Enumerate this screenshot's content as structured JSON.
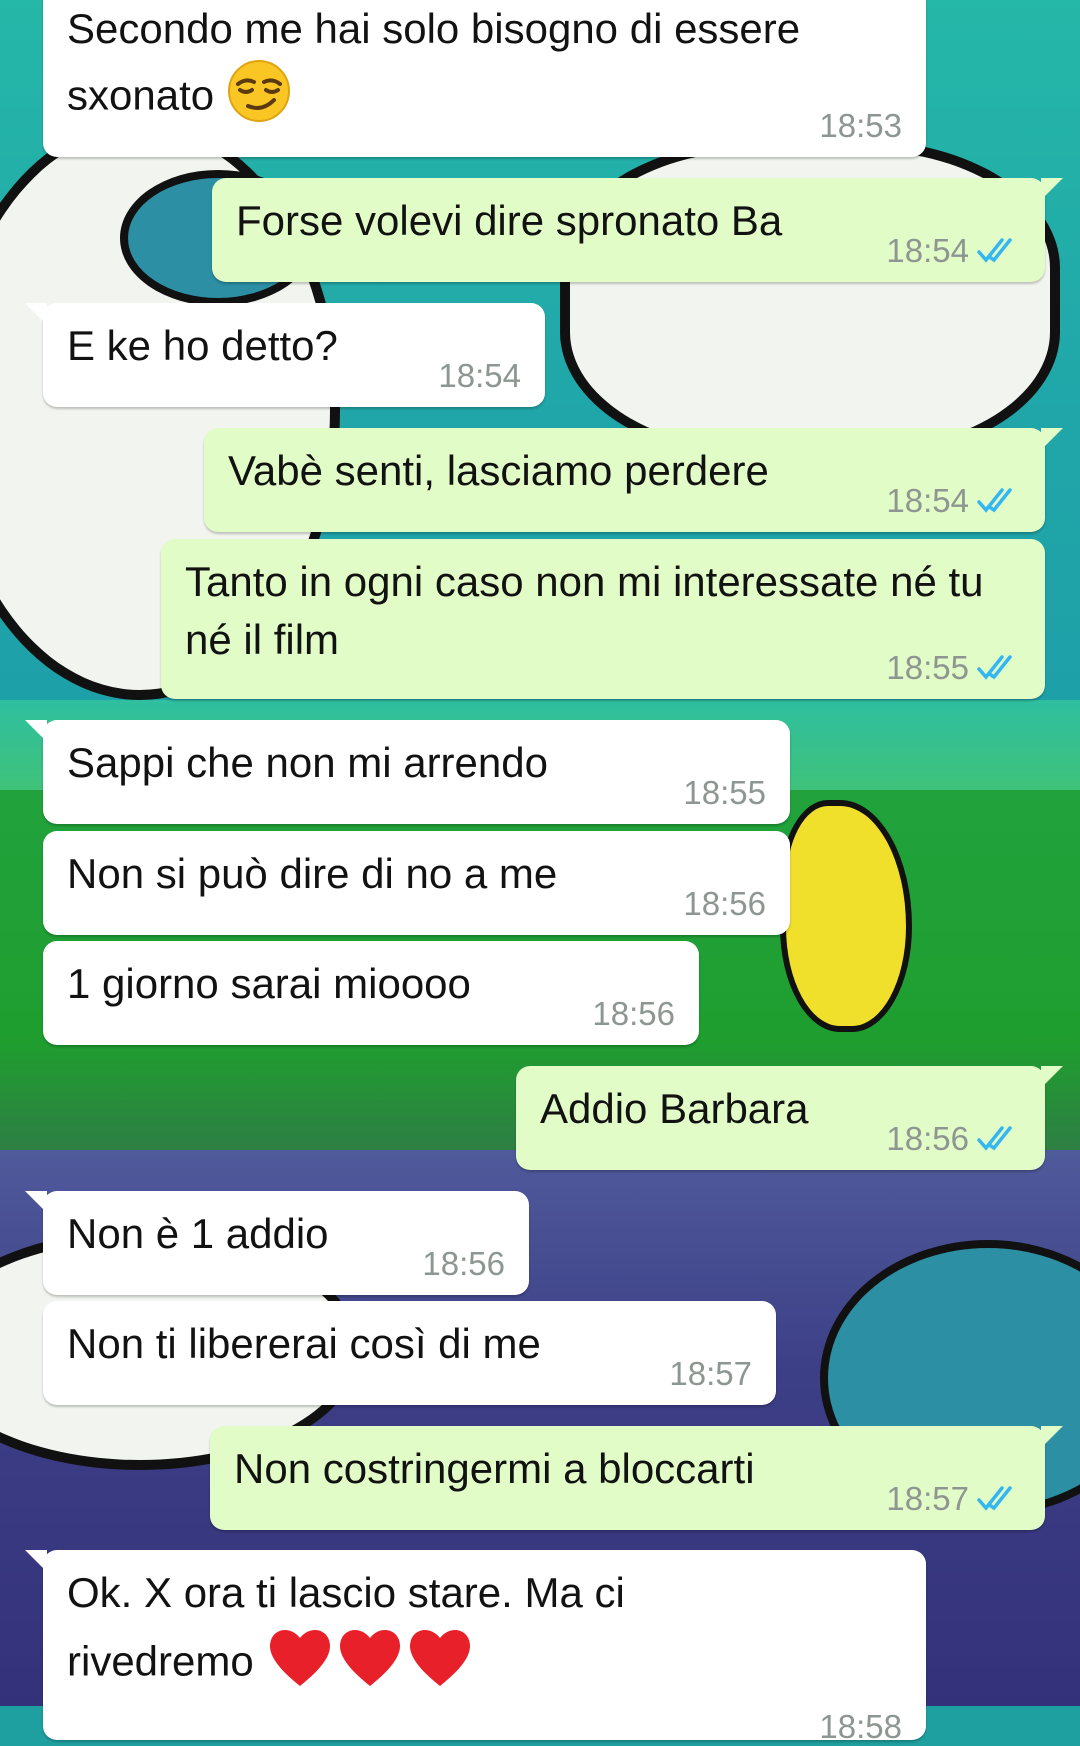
{
  "messages": [
    {
      "dir": "in",
      "text": "Secondo me hai solo bisogno di essere sxonato",
      "emoji": "smirk-face-icon",
      "time": "18:53"
    },
    {
      "dir": "out",
      "text": "Forse volevi dire spronato Ba",
      "time": "18:54",
      "status": "read"
    },
    {
      "dir": "in",
      "text": "E ke ho detto?",
      "time": "18:54"
    },
    {
      "dir": "out",
      "text": "Vabè senti, lasciamo perdere",
      "time": "18:54",
      "status": "read"
    },
    {
      "dir": "out",
      "text": "Tanto in ogni caso non mi interessate né tu né il film",
      "time": "18:55",
      "status": "read"
    },
    {
      "dir": "in",
      "text": "Sappi che non mi arrendo",
      "time": "18:55"
    },
    {
      "dir": "in",
      "text": "Non si può dire di no a me",
      "time": "18:56"
    },
    {
      "dir": "in",
      "text": "1 giorno sarai mioooo",
      "time": "18:56"
    },
    {
      "dir": "out",
      "text": "Addio Barbara",
      "time": "18:56",
      "status": "read"
    },
    {
      "dir": "in",
      "text": "Non è 1 addio",
      "time": "18:56"
    },
    {
      "dir": "in",
      "text": "Non ti libererai così di me",
      "time": "18:57"
    },
    {
      "dir": "out",
      "text": "Non costringermi a bloccarti",
      "time": "18:57",
      "status": "read"
    },
    {
      "dir": "in",
      "text": "Ok. X ora ti lascio stare. Ma ci rivedremo",
      "emoji": "red-heart-icon x3",
      "time": "18:58"
    }
  ],
  "colors": {
    "incoming_bubble": "#ffffff",
    "outgoing_bubble": "#e1fcc7",
    "timestamp": "#8d9691",
    "read_ticks": "#34b7f1"
  }
}
